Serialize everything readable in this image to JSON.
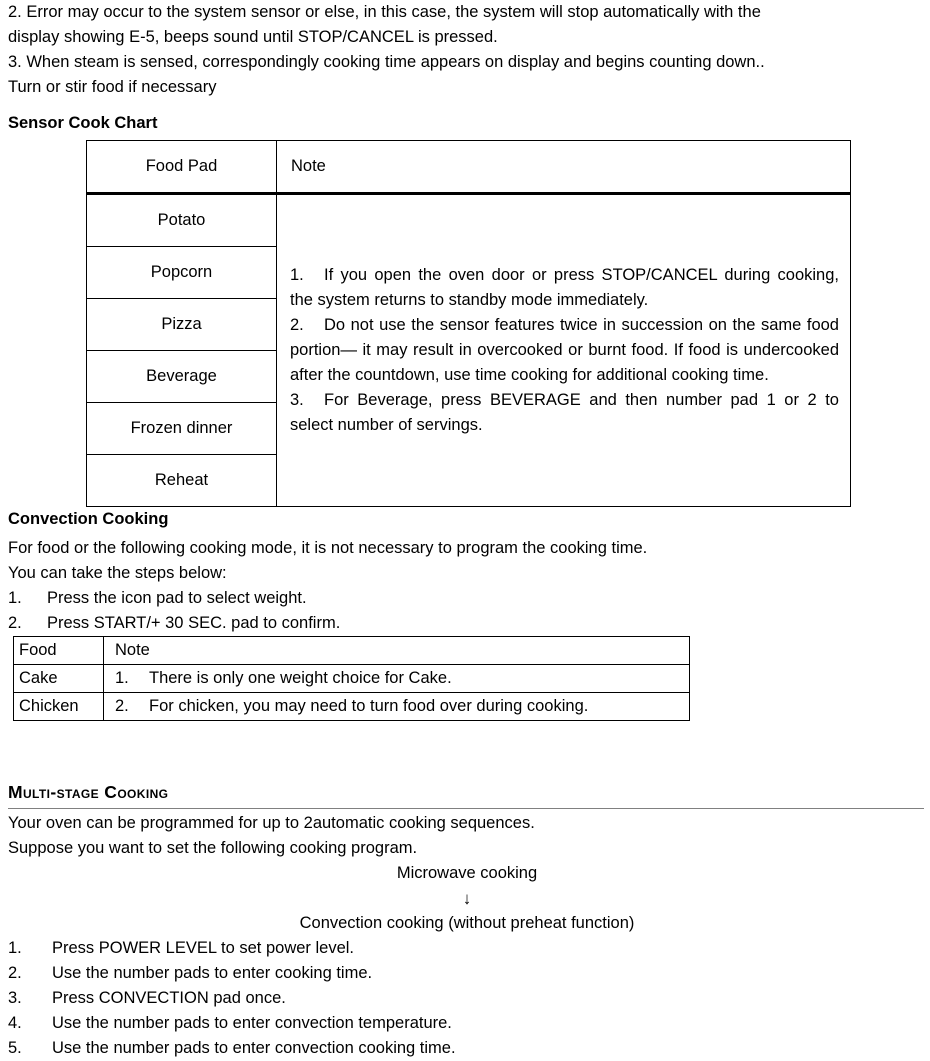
{
  "intro": {
    "lines": [
      "2. Error may occur to the system sensor or else, in this case, the system will stop automatically with the",
      "display showing E-5, beeps sound until STOP/CANCEL is pressed.",
      "3. When steam is sensed, correspondingly cooking time appears on display and begins counting down..",
      "Turn or stir food if necessary"
    ]
  },
  "sensor_chart": {
    "heading": "Sensor Cook Chart",
    "headers": {
      "food": "Food Pad",
      "note": "Note"
    },
    "food_rows": [
      "Potato",
      "Popcorn",
      "Pizza",
      "Beverage",
      "Frozen dinner",
      "Reheat"
    ],
    "notes": [
      {
        "num": "1.",
        "text": "If you open the oven door or press STOP/CANCEL during cooking, the system returns to standby mode immediately."
      },
      {
        "num": "2.",
        "text": "Do not use the sensor features twice in succession on the same food portion— it may result in overcooked or burnt food. If food is undercooked after the countdown, use time cooking for additional cooking time."
      },
      {
        "num": "3.",
        "text": "For Beverage, press BEVERAGE and then number pad 1 or 2 to select number of servings."
      }
    ]
  },
  "convection": {
    "heading": "Convection Cooking",
    "paragraphs": [
      "For food or the following cooking mode, it is not necessary to program the cooking time.",
      "You can take the steps below:"
    ],
    "steps": [
      {
        "n": "1.",
        "text": "Press the icon pad to select weight."
      },
      {
        "n": "2.",
        "text": "Press START/+ 30 SEC. pad to confirm."
      }
    ],
    "table": {
      "headers": {
        "food": "Food",
        "note": "Note"
      },
      "rows": [
        {
          "food": "Cake",
          "num": "1.",
          "note": "There is only one weight choice for Cake."
        },
        {
          "food": "Chicken",
          "num": "2.",
          "note": "For chicken, you may need to turn food over during cooking."
        }
      ]
    }
  },
  "multistage": {
    "heading": "Multi-stage Cooking",
    "paragraphs": [
      "Your oven can be programmed for up to 2automatic cooking sequences.",
      "Suppose you want to set the following cooking program."
    ],
    "diagram": {
      "stage1": "Microwave cooking",
      "arrow": "↓",
      "stage2": "Convection cooking (without preheat function)"
    },
    "steps": [
      {
        "n": "1.",
        "text": "Press POWER LEVEL to set power level."
      },
      {
        "n": "2.",
        "text": "Use the number pads to enter cooking time."
      },
      {
        "n": "3.",
        "text": "Press CONVECTION pad once."
      },
      {
        "n": "4.",
        "text": "Use the number pads to enter convection temperature."
      },
      {
        "n": "5.",
        "text": "Use the number pads to enter convection cooking time."
      }
    ]
  }
}
